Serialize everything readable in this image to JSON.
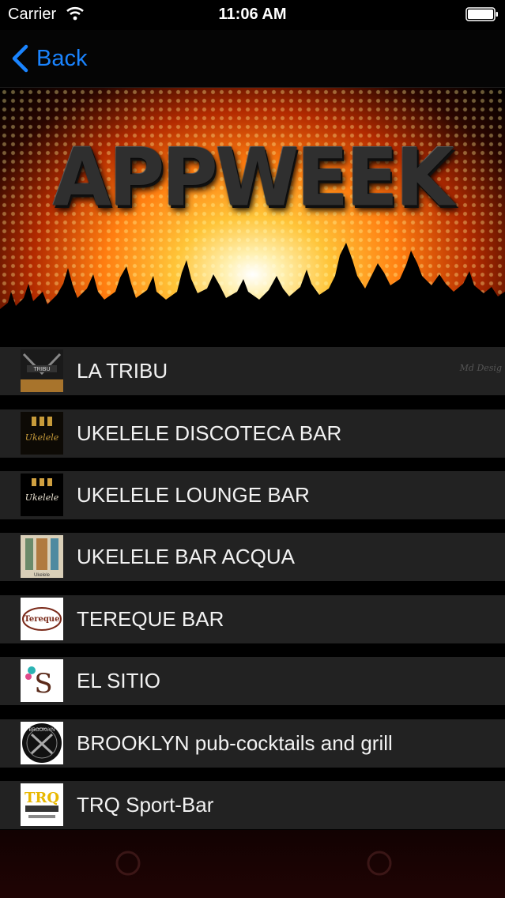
{
  "status_bar": {
    "carrier": "Carrier",
    "time": "11:06 AM",
    "wifi_icon": "wifi-icon",
    "battery_icon": "battery-icon"
  },
  "nav_bar": {
    "back_label": "Back",
    "back_icon": "chevron-left-icon",
    "accent_color": "#1a84ff"
  },
  "banner": {
    "title": "APPWEEK",
    "signature": "Md Desig"
  },
  "venues": [
    {
      "name": "LA TRIBU",
      "thumb_text": "TRIBU"
    },
    {
      "name": "UKELELE DISCOTECA BAR",
      "thumb_text": "Ukelele"
    },
    {
      "name": "UKELELE LOUNGE BAR",
      "thumb_text": "Ukelele"
    },
    {
      "name": "UKELELE BAR ACQUA",
      "thumb_text": "Ukelele"
    },
    {
      "name": "TEREQUE BAR",
      "thumb_text": "Tereque"
    },
    {
      "name": "EL SITIO",
      "thumb_text": "S"
    },
    {
      "name": "BROOKLYN pub-cocktails and grill",
      "thumb_text": "BROOKLYN"
    },
    {
      "name": "TRQ Sport-Bar",
      "thumb_text": "TRQ"
    }
  ],
  "colors": {
    "row_background": "#222222",
    "page_background": "#000000"
  }
}
